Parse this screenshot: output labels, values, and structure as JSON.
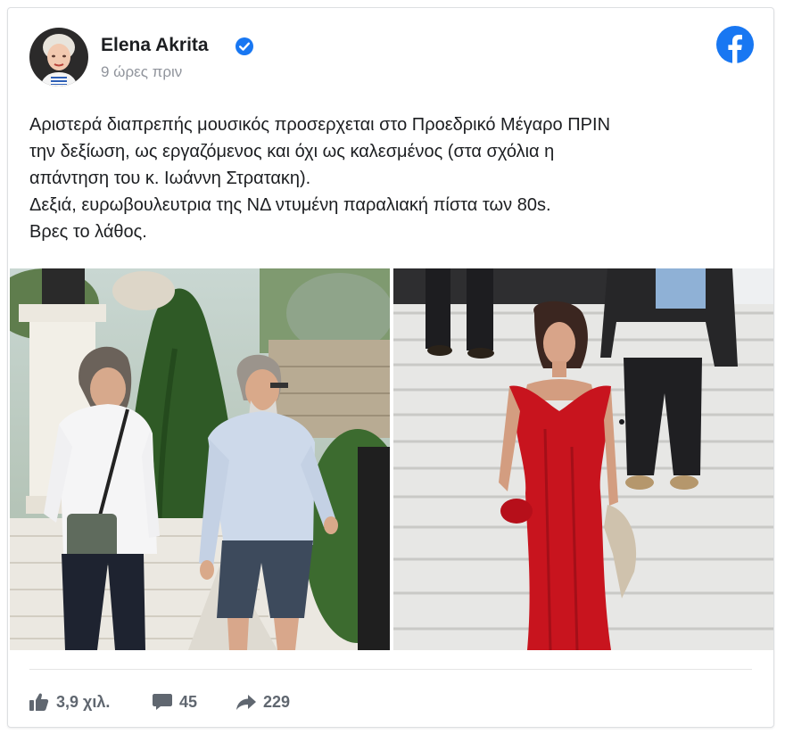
{
  "post": {
    "author": "Elena Akrita",
    "timestamp": "9 ώρες πριν",
    "text_lines": [
      "Αριστερά διαπρεπής μουσικός προσερχεται στο Προεδρικό Μέγαρο ΠΡΙΝ",
      "την δεξίωση, ως εργαζόμενος και όχι ως καλεσμένος (στα σχόλια η",
      "απάντηση του κ. Ιωάννη Στρατακη).",
      "Δεξιά, ευρωβουλευτρια της ΝΔ ντυμένη παραλιακή πίστα των 80s.",
      "Βρες το λάθος."
    ]
  },
  "stats": {
    "likes": "3,9 χιλ.",
    "comments": "45",
    "shares": "229"
  },
  "colors": {
    "facebook_blue": "#1877f2",
    "dress_red": "#c8141e",
    "meta_text": "#606770"
  },
  "icons": {
    "verified": "verified-badge-icon",
    "logo": "facebook-logo-icon",
    "like": "thumbs-up-icon",
    "comment": "comment-bubble-icon",
    "share": "share-arrow-icon"
  }
}
